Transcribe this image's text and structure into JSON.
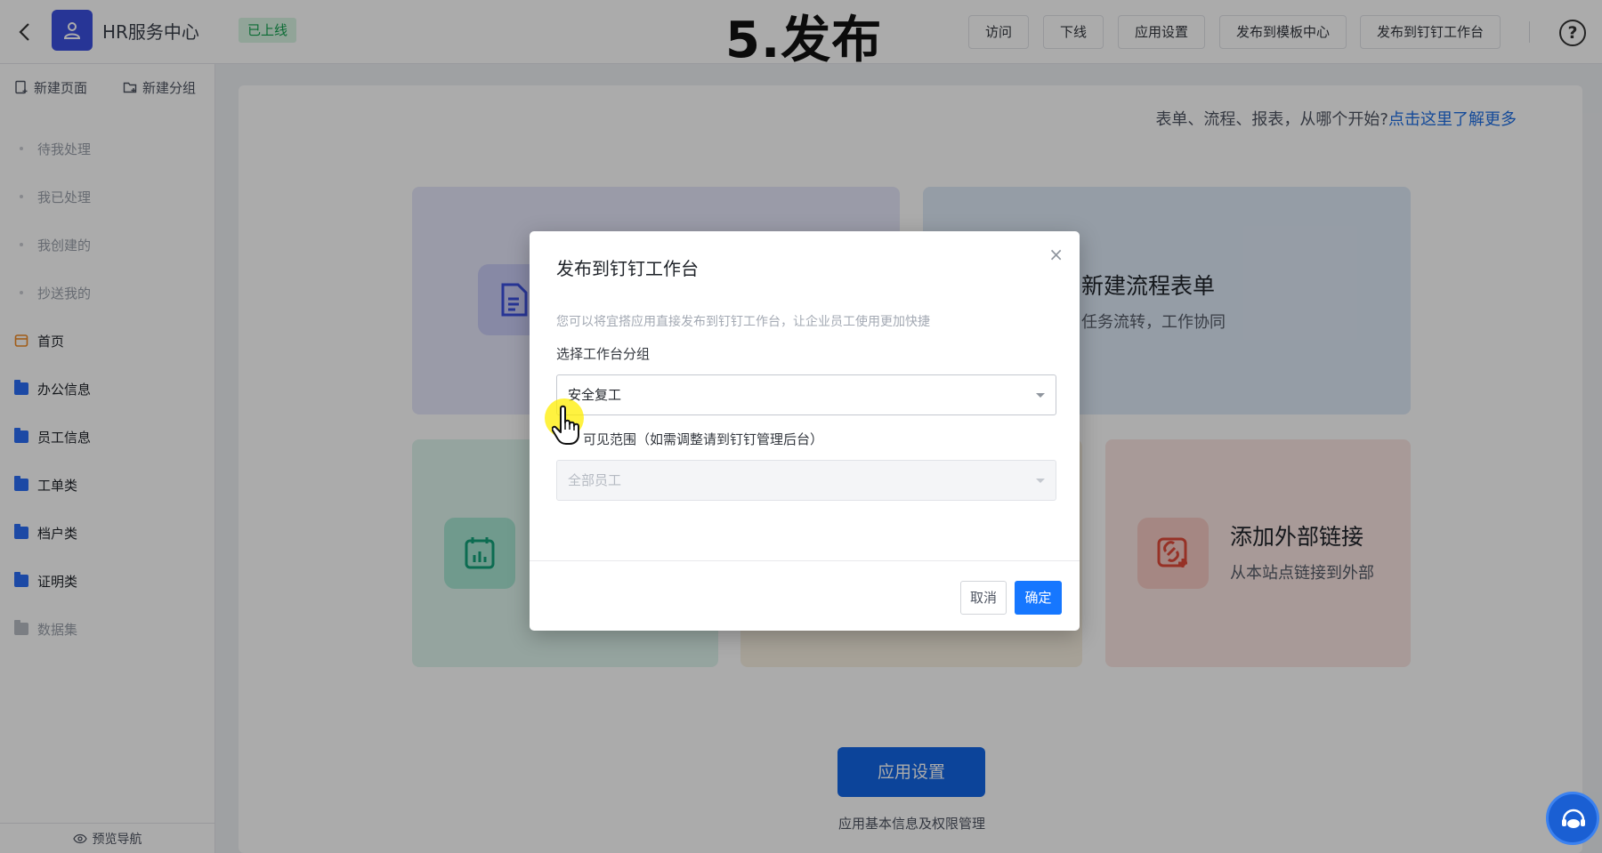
{
  "header": {
    "app_name": "HR服务中心",
    "status": "已上线",
    "page_title": "5.发布",
    "buttons": [
      "访问",
      "下线",
      "应用设置",
      "发布到模板中心",
      "发布到钉钉工作台"
    ],
    "help": "?"
  },
  "sidebar": {
    "new_page": "新建页面",
    "new_group": "新建分组",
    "sub_items": [
      "待我处理",
      "我已处理",
      "我创建的",
      "抄送我的"
    ],
    "home": "首页",
    "folders": [
      "办公信息",
      "员工信息",
      "工单类",
      "档户类",
      "证明类"
    ],
    "dataset": "数据集",
    "preview_nav": "预览导航"
  },
  "main": {
    "hint_text": "表单、流程、报表，从哪个开始?",
    "hint_link": "点击这里了解更多",
    "card_process_title": "新建流程表单",
    "card_process_sub": "任务流转，工作协同",
    "card_link_title": "添加外部链接",
    "card_link_sub": "从本站点链接到外部",
    "settings_button": "应用设置",
    "settings_sub": "应用基本信息及权限管理"
  },
  "modal": {
    "title": "发布到钉钉工作台",
    "close": "×",
    "description": "您可以将宜搭应用直接发布到钉钉工作台，让企业员工使用更加快捷",
    "group_label": "选择工作台分组",
    "group_value": "安全复工",
    "scope_label": "可见范围（如需调整请到钉钉管理后台）",
    "scope_value": "全部员工",
    "cancel": "取消",
    "confirm": "确定"
  },
  "colors": {
    "primary": "#1677ff",
    "app_logo": "#3b4fe0",
    "status_green": "#12a150",
    "folder_blue": "#2b6ef6"
  }
}
